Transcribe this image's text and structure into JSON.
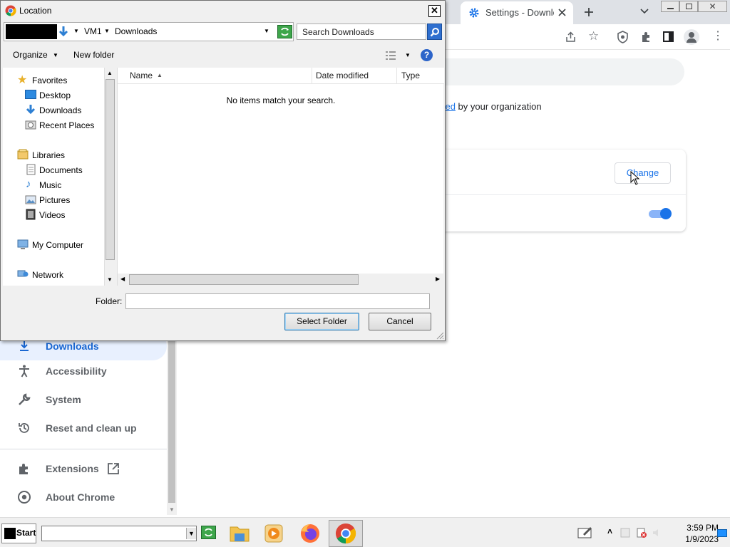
{
  "window": {
    "tab_title": "Settings - Downlo"
  },
  "settings": {
    "managed_link": "aged",
    "managed_suffix": " by your organization",
    "change_label": "Change",
    "sidebar": [
      {
        "label": "Downloads"
      },
      {
        "label": "Accessibility"
      },
      {
        "label": "System"
      },
      {
        "label": "Reset and clean up"
      },
      {
        "label": "Extensions"
      },
      {
        "label": "About Chrome"
      }
    ]
  },
  "dialog": {
    "title": "Location",
    "path": [
      "VM1",
      "Downloads"
    ],
    "search_placeholder": "Search Downloads",
    "organize_label": "Organize",
    "new_folder_label": "New folder",
    "nav": {
      "favorites": "Favorites",
      "favorites_items": [
        "Desktop",
        "Downloads",
        "Recent Places"
      ],
      "libraries": "Libraries",
      "libraries_items": [
        "Documents",
        "Music",
        "Pictures",
        "Videos"
      ],
      "computer": "My Computer",
      "network": "Network"
    },
    "columns": [
      "Name",
      "Date modified",
      "Type"
    ],
    "empty_message": "No items match your search.",
    "folder_label": "Folder:",
    "folder_value": "",
    "select_label": "Select Folder",
    "cancel_label": "Cancel"
  },
  "taskbar": {
    "start_label": "Start",
    "time": "3:59 PM",
    "date": "1/9/2023"
  }
}
